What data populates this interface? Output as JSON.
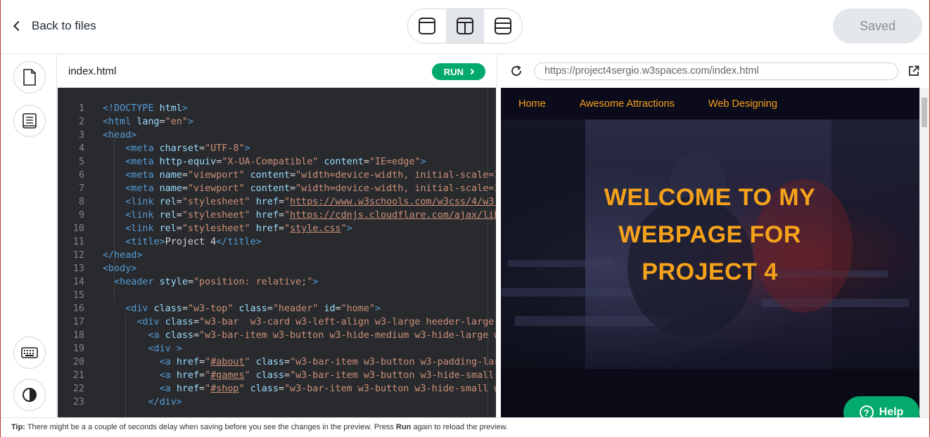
{
  "header": {
    "back_label": "Back to files",
    "saved_label": "Saved",
    "layout_icons": [
      "layout-single-icon",
      "layout-split-vertical-icon",
      "layout-split-horizontal-icon"
    ]
  },
  "rail": {
    "icons": [
      "file-icon",
      "book-icon",
      "keyboard-icon",
      "contrast-icon"
    ]
  },
  "editor": {
    "filename": "index.html",
    "run_label": "RUN",
    "line_numbers": [
      "1",
      "2",
      "3",
      "4",
      "5",
      "6",
      "7",
      "8",
      "9",
      "10",
      "11",
      "12",
      "13",
      "14",
      "15",
      "16",
      "17",
      "18",
      "19",
      "20",
      "21",
      "22",
      "23"
    ]
  },
  "preview": {
    "url": "https://project4sergio.w3spaces.com/index.html",
    "nav": [
      "Home",
      "Awesome Attractions",
      "Web Designing"
    ],
    "hero_lines": [
      "WELCOME TO MY",
      "WEBPAGE FOR",
      "PROJECT 4"
    ],
    "help_label": "Help"
  },
  "tip": {
    "label": "Tip:",
    "text_before": " There might be a a couple of seconds delay when saving before you see the changes in the preview. Press ",
    "run_word": "Run",
    "text_after": " again to reload the preview."
  },
  "colors": {
    "accent_green": "#04aa6d",
    "preview_orange": "#f5a21b",
    "editor_bg": "#282a2e"
  }
}
